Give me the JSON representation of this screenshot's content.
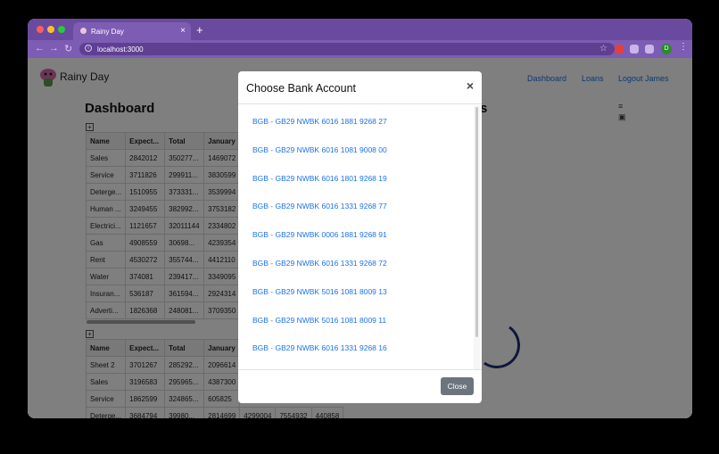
{
  "browser": {
    "tab_title": "Rainy Day",
    "new_tab": "+",
    "tab_close": "×",
    "url": "localhost:3000",
    "profile_initial": "D",
    "colors": {
      "frame": "#6a4a9e",
      "toolbar": "#7d5cb4"
    }
  },
  "app": {
    "brand": "Rainy Day",
    "nav": [
      "Dashboard",
      "Loans",
      "Logout James"
    ],
    "page_title": "Dashboard",
    "partial_title_suffix": "s"
  },
  "table1": {
    "headers": [
      "Name",
      "Expect...",
      "Total",
      "January"
    ],
    "rows": [
      [
        "Sales",
        "2842012",
        "350277...",
        "1469072"
      ],
      [
        "Service",
        "3711826",
        "299911...",
        "3830599"
      ],
      [
        "Deterge...",
        "1510955",
        "373331...",
        "3539994"
      ],
      [
        "Human ...",
        "3249455",
        "382992...",
        "3753182"
      ],
      [
        "Electrici...",
        "1121657",
        "32011144",
        "2334802"
      ],
      [
        "Gas",
        "4908559",
        "30698...",
        "4239354"
      ],
      [
        "Rent",
        "4530272",
        "355744...",
        "4412110"
      ],
      [
        "Water",
        "374081",
        "239417...",
        "3349095"
      ],
      [
        "Insuran...",
        "536187",
        "361594...",
        "2924314"
      ],
      [
        "Adverti...",
        "1826368",
        "248081...",
        "3709350"
      ]
    ]
  },
  "table2": {
    "headers": [
      "Name",
      "Expect...",
      "Total",
      "January"
    ],
    "rows": [
      [
        "Sheet 2",
        "3701267",
        "285292...",
        "2096614"
      ],
      [
        "Sales",
        "3196583",
        "295965...",
        "4387300"
      ],
      [
        "Service",
        "1862599",
        "324865...",
        "605825"
      ],
      [
        "Deterge...",
        "3684794",
        "39980...",
        "2814699",
        "4299004",
        "7554932",
        "440858"
      ]
    ]
  },
  "modal": {
    "title": "Choose Bank Account",
    "close_symbol": "×",
    "accounts": [
      "BGB - GB29 NWBK 6016 1881 9268 27",
      "BGB - GB29 NWBK 6016 1081 9008 00",
      "BGB - GB29 NWBK 6016 1801 9268 19",
      "BGB - GB29 NWBK 6016 1331 9268 77",
      "BGB - GB29 NWBK 0006 1881 9268 91",
      "BGB - GB29 NWBK 6016 1331 9268 72",
      "BGB - GB29 NWBK 5016 1081 8009 13",
      "BGB - GB29 NWBK 5016 1081 8009 11",
      "BGB - GB29 NWBK 6016 1331 9268 16"
    ],
    "close_button": "Close",
    "colors": {
      "link": "#1a73e8",
      "button": "#6c757d"
    }
  }
}
